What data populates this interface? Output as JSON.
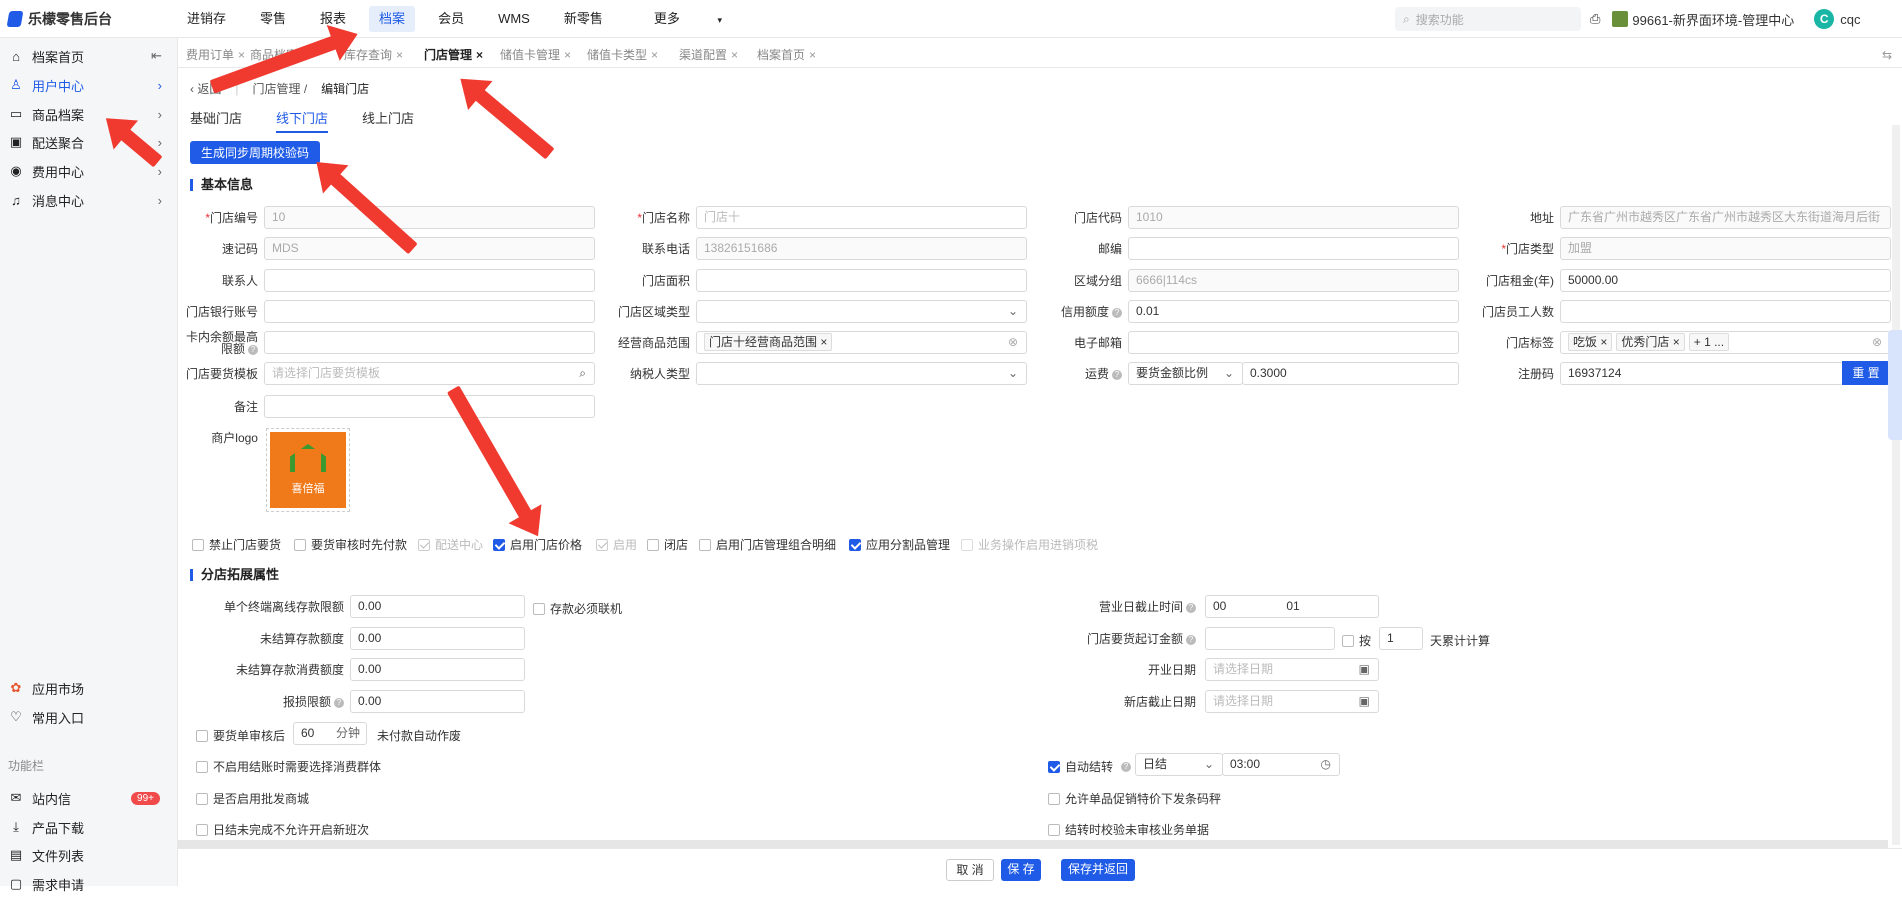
{
  "app": {
    "title": "乐檬零售后台"
  },
  "topnav": [
    "进销存",
    "零售",
    "报表",
    "档案",
    "会员",
    "WMS",
    "新零售",
    "更多"
  ],
  "search": {
    "placeholder": "搜索功能"
  },
  "org": {
    "name": "99661-新界面环境-管理中心"
  },
  "user": {
    "initial": "C",
    "name": "cqc"
  },
  "sidebar": {
    "items": [
      {
        "label": "档案首页",
        "icon": "home-icon"
      },
      {
        "label": "用户中心",
        "icon": "user-icon"
      },
      {
        "label": "商品档案",
        "icon": "goods-icon"
      },
      {
        "label": "配送聚合",
        "icon": "box-icon"
      },
      {
        "label": "费用中心",
        "icon": "fee-icon"
      },
      {
        "label": "消息中心",
        "icon": "bell-icon"
      }
    ],
    "bottom": [
      {
        "label": "应用市场",
        "icon": "apps-icon"
      },
      {
        "label": "常用入口",
        "icon": "heart-icon"
      }
    ],
    "group_label": "功能栏",
    "tools": [
      {
        "label": "站内信",
        "badge": "99+"
      },
      {
        "label": "产品下载"
      },
      {
        "label": "文件列表"
      },
      {
        "label": "需求申请"
      }
    ]
  },
  "tabs": [
    "费用订单",
    "商品档案",
    "库存查询",
    "门店管理",
    "储值卡管理",
    "储值卡类型",
    "渠道配置",
    "档案首页"
  ],
  "breadcrumb": {
    "back": "返回",
    "parent": "门店管理",
    "current": "编辑门店"
  },
  "subtabs": [
    "基础门店",
    "线下门店",
    "线上门店"
  ],
  "gen_button": "生成同步周期校验码",
  "section_basic": "基本信息",
  "fields": {
    "store_code": {
      "label": "门店编号",
      "value": "10"
    },
    "store_name": {
      "label": "门店名称",
      "placeholder": "门店十"
    },
    "store_dm": {
      "label": "门店代码",
      "value": "1010"
    },
    "address": {
      "label": "地址",
      "value": "广东省广州市越秀区广东省广州市越秀区大东街道海月后街"
    },
    "quick_code": {
      "label": "速记码",
      "value": "MDS"
    },
    "phone": {
      "label": "联系电话",
      "value": "13826151686"
    },
    "zip": {
      "label": "邮编",
      "value": ""
    },
    "store_type": {
      "label": "门店类型",
      "value": "加盟"
    },
    "contact": {
      "label": "联系人",
      "value": ""
    },
    "area": {
      "label": "门店面积",
      "value": ""
    },
    "region_group": {
      "label": "区域分组",
      "value": "6666|114cs"
    },
    "rent": {
      "label": "门店租金(年)",
      "value": "50000.00"
    },
    "bank": {
      "label": "门店银行账号",
      "value": ""
    },
    "region_type": {
      "label": "门店区域类型",
      "value": ""
    },
    "credit": {
      "label": "信用额度",
      "value": "0.01"
    },
    "staff": {
      "label": "门店员工人数",
      "value": ""
    },
    "card_max": {
      "label": "卡内余额最高限额",
      "value": ""
    },
    "scope": {
      "label": "经营商品范围",
      "tag": "门店十经营商品范围"
    },
    "email": {
      "label": "电子邮箱",
      "value": ""
    },
    "store_tags": {
      "label": "门店标签",
      "tags": [
        "吃饭",
        "优秀门店",
        "+ 1 ..."
      ]
    },
    "template": {
      "label": "门店要货模板",
      "placeholder": "请选择门店要货模板"
    },
    "tax_type": {
      "label": "纳税人类型",
      "value": ""
    },
    "freight": {
      "label": "运费",
      "mode": "要货金额比例",
      "value": "0.3000"
    },
    "reg_code": {
      "label": "注册码",
      "value": "16937124",
      "button": "重 置"
    },
    "remark": {
      "label": "备注",
      "value": ""
    },
    "logo": {
      "label": "商户logo",
      "text": "喜倍福"
    }
  },
  "checks": [
    {
      "label": "禁止门店要货",
      "state": "off"
    },
    {
      "label": "要货审核时先付款",
      "state": "off"
    },
    {
      "label": "配送中心",
      "state": "dis"
    },
    {
      "label": "启用门店价格",
      "state": "on"
    },
    {
      "label": "启用",
      "state": "dis"
    },
    {
      "label": "闭店",
      "state": "off"
    },
    {
      "label": "启用门店管理组合明细",
      "state": "off"
    },
    {
      "label": "应用分割品管理",
      "state": "on"
    },
    {
      "label": "业务操作启用进销项税",
      "state": "disoff"
    }
  ],
  "section_ext": "分店拓展属性",
  "ext": {
    "offline_limit": {
      "label": "单个终端离线存款限额",
      "value": "0.00"
    },
    "must_online": {
      "label": "存款必须联机"
    },
    "unsettled_amt": {
      "label": "未结算存款额度",
      "value": "0.00"
    },
    "unsettled_consume": {
      "label": "未结算存款消费额度",
      "value": "0.00"
    },
    "loss_limit": {
      "label": "报损限额",
      "value": "0.00"
    },
    "cutoff": {
      "label": "营业日截止时间",
      "h": "00",
      "m": "01"
    },
    "min_order": {
      "label": "门店要货起订金额",
      "value": "",
      "by": "按",
      "days": "1",
      "suffix": "天累计计算"
    },
    "open_date": {
      "label": "开业日期",
      "placeholder": "请选择日期"
    },
    "new_end": {
      "label": "新店截止日期",
      "placeholder": "请选择日期"
    },
    "auto_void": {
      "pre": "要货单审核后",
      "minutes": "60",
      "unit": "分钟",
      "post": "未付款自动作废"
    },
    "auto_settle": {
      "label": "自动结转",
      "mode": "日结",
      "time": "03:00"
    },
    "opts": [
      "不启用结账时需要选择消费群体",
      "是否启用批发商城",
      "日结未完成不允许开启新班次"
    ],
    "opts_right": [
      "允许单品促销特价下发条码秤",
      "结转时校验未审核业务单据"
    ]
  },
  "footer": {
    "cancel": "取 消",
    "save": "保 存",
    "save_back": "保存并返回"
  }
}
